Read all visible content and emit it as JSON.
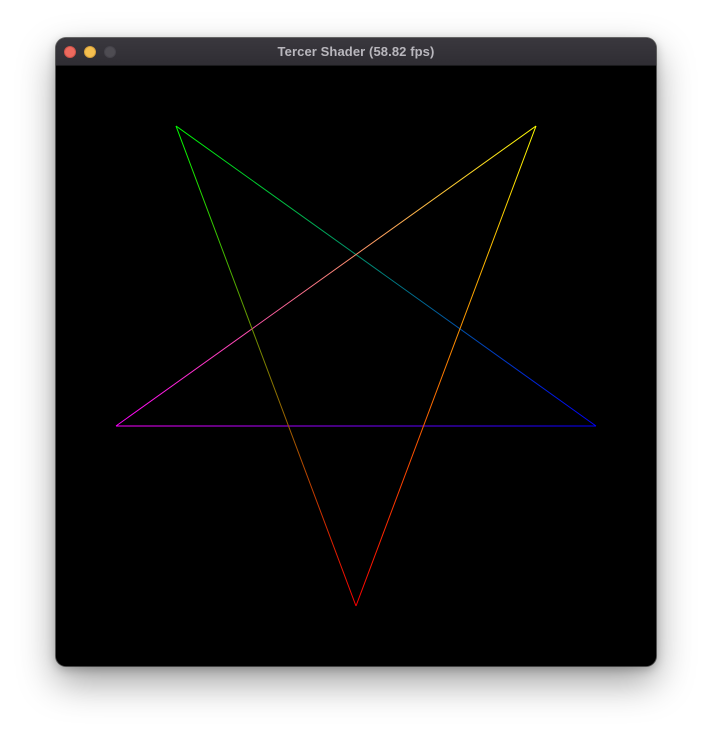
{
  "window": {
    "title": "Tercer Shader (58.82 fps)",
    "controls": {
      "close_color": "#ed6a5e",
      "minimize_color": "#f5bf4f",
      "zoom_color": "#4e4c52"
    }
  },
  "viewport": {
    "background": "#000000",
    "shape": "pentagram",
    "segments": [
      {
        "name": "top-left-to-right",
        "from_color": "#00ff00",
        "to_color": "#0000ff"
      },
      {
        "name": "right-to-left",
        "from_color": "#0000ff",
        "to_color": "#ff00ff"
      },
      {
        "name": "left-to-top-right",
        "from_color": "#ff00ff",
        "to_color": "#ffff00"
      },
      {
        "name": "top-right-to-bottom",
        "from_color": "#ffff00",
        "to_color": "#ff0000"
      },
      {
        "name": "bottom-to-top-left",
        "from_color": "#ff0000",
        "to_color": "#00ff00"
      }
    ]
  }
}
